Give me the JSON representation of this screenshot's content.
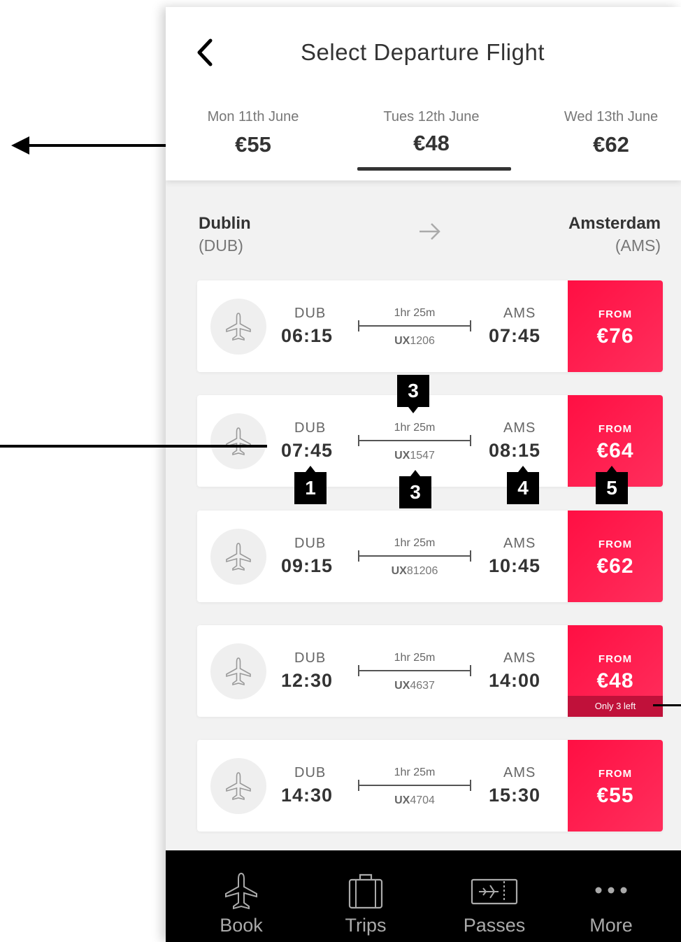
{
  "header": {
    "title": "Select Departure Flight",
    "back_icon": "chevron-left-icon"
  },
  "dates": [
    {
      "day": "Mon 11th June",
      "price": "€55"
    },
    {
      "day": "Tues 12th June",
      "price": "€48",
      "selected": true
    },
    {
      "day": "Wed 13th June",
      "price": "€62"
    }
  ],
  "route": {
    "origin_city": "Dublin",
    "origin_code": "(DUB)",
    "dest_city": "Amsterdam",
    "dest_code": "(AMS)"
  },
  "flights": [
    {
      "from_code": "DUB",
      "depart": "06:15",
      "duration": "1hr 25m",
      "carrier": "UX",
      "number": "1206",
      "to_code": "AMS",
      "arrive": "07:45",
      "price_label": "FROM",
      "price": "€76"
    },
    {
      "from_code": "DUB",
      "depart": "07:45",
      "duration": "1hr 25m",
      "carrier": "UX",
      "number": "1547",
      "to_code": "AMS",
      "arrive": "08:15",
      "price_label": "FROM",
      "price": "€64"
    },
    {
      "from_code": "DUB",
      "depart": "09:15",
      "duration": "1hr 25m",
      "carrier": "UX",
      "number": "81206",
      "to_code": "AMS",
      "arrive": "10:45",
      "price_label": "FROM",
      "price": "€62"
    },
    {
      "from_code": "DUB",
      "depart": "12:30",
      "duration": "1hr 25m",
      "carrier": "UX",
      "number": "4637",
      "to_code": "AMS",
      "arrive": "14:00",
      "price_label": "FROM",
      "price": "€48",
      "availability": "Only 3 left"
    },
    {
      "from_code": "DUB",
      "depart": "14:30",
      "duration": "1hr 25m",
      "carrier": "UX",
      "number": "4704",
      "to_code": "AMS",
      "arrive": "15:30",
      "price_label": "FROM",
      "price": "€55"
    }
  ],
  "annotations": [
    "1",
    "3",
    "3",
    "4",
    "5"
  ],
  "nav": [
    {
      "label": "Book",
      "icon": "plane-icon"
    },
    {
      "label": "Trips",
      "icon": "suitcase-icon"
    },
    {
      "label": "Passes",
      "icon": "boarding-pass-icon"
    },
    {
      "label": "More",
      "icon": "more-dots-icon"
    }
  ],
  "colors": {
    "accent": "#ff1a4b",
    "availability_bg": "#c0113a",
    "nav_bg": "#000000"
  }
}
